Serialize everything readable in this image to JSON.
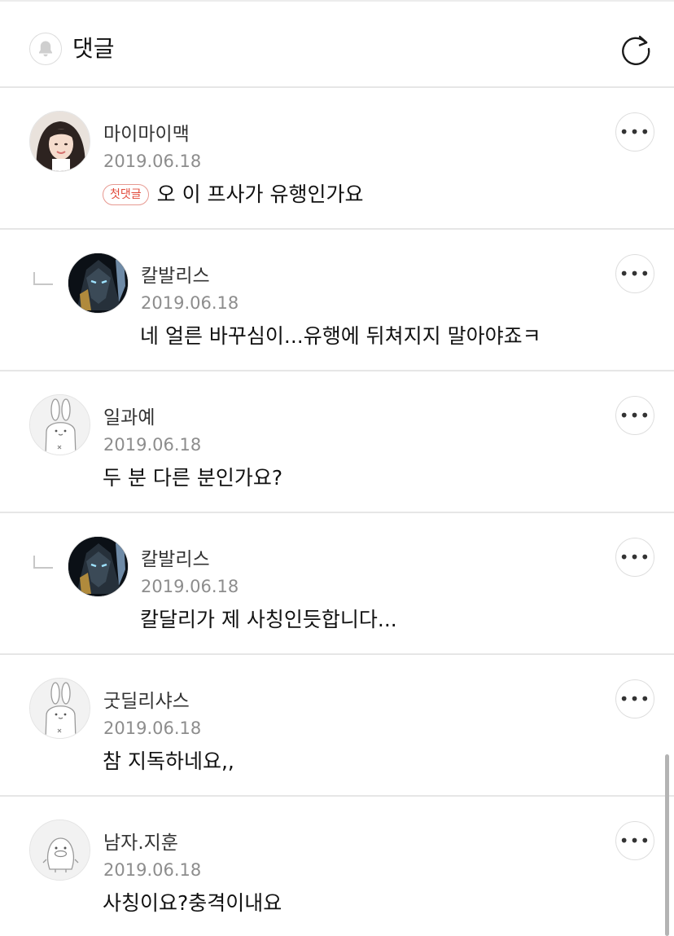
{
  "header": {
    "title": "댓글",
    "bell_icon": "bell-icon",
    "refresh_icon": "refresh-icon"
  },
  "comments": [
    {
      "author": "마이마이맥",
      "date": "2019.06.18",
      "badge": "첫댓글",
      "text": "오 이 프사가 유행인가요",
      "is_reply": false,
      "avatar": "profile-photo-woman"
    },
    {
      "author": "칼발리스",
      "date": "2019.06.18",
      "text": "네 얼른 바꾸심이...유행에 뒤쳐지지 말아야죠ㅋ",
      "is_reply": true,
      "avatar": "profile-photo-dark-armor"
    },
    {
      "author": "일과예",
      "date": "2019.06.18",
      "text": "두 분 다른 분인가요?",
      "is_reply": false,
      "avatar": "default-rabbit-avatar"
    },
    {
      "author": "칼발리스",
      "date": "2019.06.18",
      "text": "칼달리가 제 사칭인듯합니다...",
      "is_reply": true,
      "avatar": "profile-photo-dark-armor"
    },
    {
      "author": "굿딜리샤스",
      "date": "2019.06.18",
      "text": "참 지독하네요,,",
      "is_reply": false,
      "avatar": "default-rabbit-avatar"
    },
    {
      "author": "남자.지훈",
      "date": "2019.06.18",
      "text": "사칭이요?충격이내요",
      "is_reply": false,
      "avatar": "default-bird-avatar"
    }
  ],
  "colors": {
    "divider": "#e6e6e6",
    "badge_red": "#e14b3b",
    "date_gray": "#8d8d8d"
  }
}
